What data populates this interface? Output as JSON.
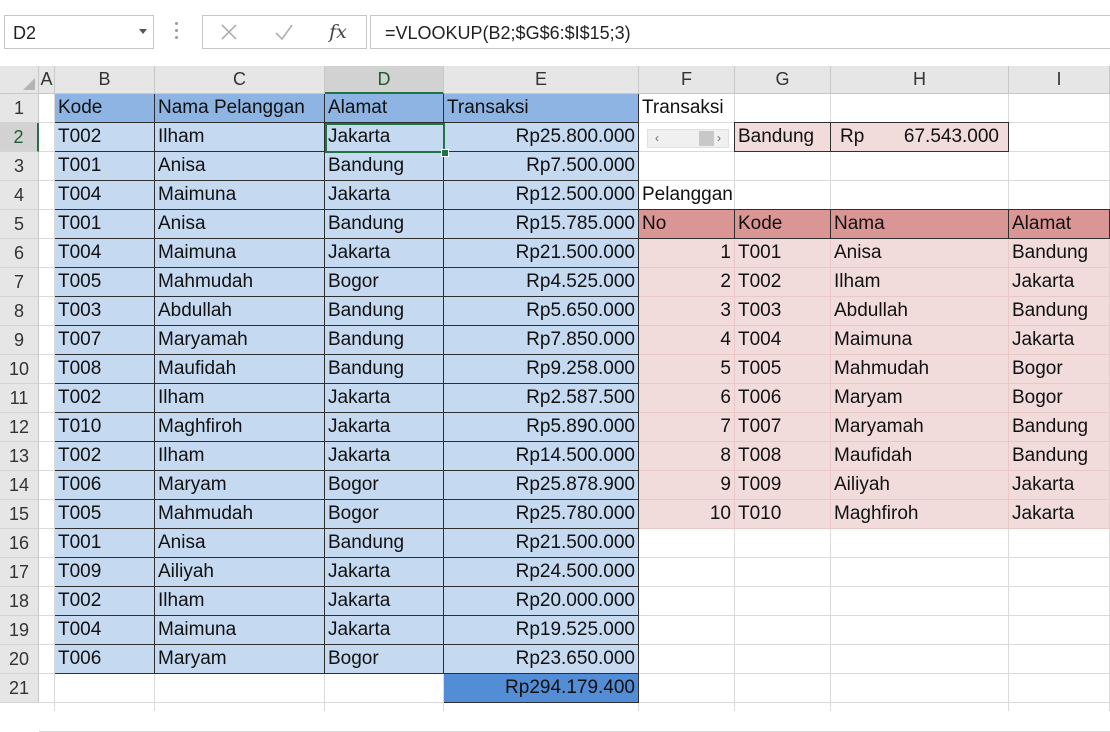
{
  "formula_bar": {
    "name_box": "D2",
    "formula": "=VLOOKUP(B2;$G$6:$I$15;3)",
    "cancel_icon": "cancel-x-icon",
    "enter_icon": "enter-check-icon",
    "fx_icon": "insert-function-icon"
  },
  "selected": {
    "column": "D",
    "row": "2"
  },
  "columns": [
    "A",
    "B",
    "C",
    "D",
    "E",
    "F",
    "G",
    "H",
    "I"
  ],
  "rows": [
    "1",
    "2",
    "3",
    "4",
    "5",
    "6",
    "7",
    "8",
    "9",
    "10",
    "11",
    "12",
    "13",
    "14",
    "15",
    "16",
    "17",
    "18",
    "19",
    "20",
    "21"
  ],
  "colors": {
    "data_fill": "#c5d9f1",
    "header_fill": "#8db4e2",
    "total_fill": "#538dd5",
    "lookup_header_fill": "#da9694",
    "lookup_fill": "#f2dcdb",
    "selection": "#217346"
  },
  "main_table": {
    "headers": [
      "Kode",
      "Nama Pelanggan",
      "Alamat",
      "Transaksi"
    ],
    "rows": [
      [
        "T002",
        "Ilham",
        "Jakarta",
        "Rp25.800.000"
      ],
      [
        "T001",
        "Anisa",
        "Bandung",
        "Rp7.500.000"
      ],
      [
        "T004",
        "Maimuna",
        "Jakarta",
        "Rp12.500.000"
      ],
      [
        "T001",
        "Anisa",
        "Bandung",
        "Rp15.785.000"
      ],
      [
        "T004",
        "Maimuna",
        "Jakarta",
        "Rp21.500.000"
      ],
      [
        "T005",
        "Mahmudah",
        "Bogor",
        "Rp4.525.000"
      ],
      [
        "T003",
        "Abdullah",
        "Bandung",
        "Rp5.650.000"
      ],
      [
        "T007",
        "Maryamah",
        "Bandung",
        "Rp7.850.000"
      ],
      [
        "T008",
        "Maufidah",
        "Bandung",
        "Rp9.258.000"
      ],
      [
        "T002",
        "Ilham",
        "Jakarta",
        "Rp2.587.500"
      ],
      [
        "T010",
        "Maghfiroh",
        "Jakarta",
        "Rp5.890.000"
      ],
      [
        "T002",
        "Ilham",
        "Jakarta",
        "Rp14.500.000"
      ],
      [
        "T006",
        "Maryam",
        "Bogor",
        "Rp25.878.900"
      ],
      [
        "T005",
        "Mahmudah",
        "Bogor",
        "Rp25.780.000"
      ],
      [
        "T001",
        "Anisa",
        "Bandung",
        "Rp21.500.000"
      ],
      [
        "T009",
        "Ailiyah",
        "Jakarta",
        "Rp24.500.000"
      ],
      [
        "T002",
        "Ilham",
        "Jakarta",
        "Rp20.000.000"
      ],
      [
        "T004",
        "Maimuna",
        "Jakarta",
        "Rp19.525.000"
      ],
      [
        "T006",
        "Maryam",
        "Bogor",
        "Rp23.650.000"
      ]
    ],
    "total": "Rp294.179.400"
  },
  "transaksi_summary": {
    "label": "Transaksi",
    "city": "Bandung",
    "currency": "Rp",
    "amount": "67.543.000"
  },
  "pelanggan_table": {
    "title": "Pelanggan",
    "headers": [
      "No",
      "Kode",
      "Nama",
      "Alamat"
    ],
    "rows": [
      [
        "1",
        "T001",
        "Anisa",
        "Bandung"
      ],
      [
        "2",
        "T002",
        "Ilham",
        "Jakarta"
      ],
      [
        "3",
        "T003",
        "Abdullah",
        "Bandung"
      ],
      [
        "4",
        "T004",
        "Maimuna",
        "Jakarta"
      ],
      [
        "5",
        "T005",
        "Mahmudah",
        "Bogor"
      ],
      [
        "6",
        "T006",
        "Maryam",
        "Bogor"
      ],
      [
        "7",
        "T007",
        "Maryamah",
        "Bandung"
      ],
      [
        "8",
        "T008",
        "Maufidah",
        "Bandung"
      ],
      [
        "9",
        "T009",
        "Ailiyah",
        "Jakarta"
      ],
      [
        "10",
        "T010",
        "Maghfiroh",
        "Jakarta"
      ]
    ]
  }
}
